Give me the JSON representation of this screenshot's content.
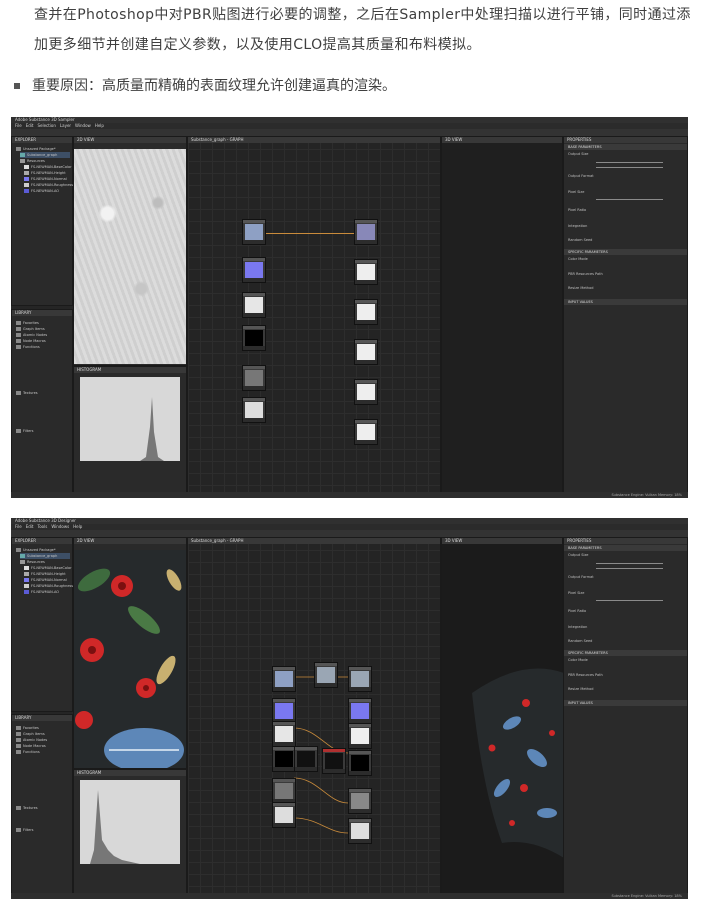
{
  "article": {
    "paragraph": "查并在Photoshop中对PBR贴图进行必要的调整，之后在Sampler中处理扫描以进行平铺，同时通过添加更多细节并创建自定义参数，以及使用CLO提高其质量和布料模拟。",
    "bullet": "重要原因：高质量而精确的表面纹理允许创建逼真的渲染。"
  },
  "screenshots": [
    {
      "window_title": "Adobe Substance 3D Sampler",
      "menu": [
        "File",
        "Edit",
        "Selection",
        "Layer",
        "Window",
        "Help"
      ],
      "explorer_title": "EXPLORER",
      "explorer_items": [
        "Unsaved Package*",
        "Substance_graph",
        "Resources",
        "FS-NEWMAN-BaseColor",
        "FS-NEWMAN-Height",
        "FS-NEWMAN-Normal",
        "FS-NEWMAN-Roughness",
        "FS-NEWMAN-AO"
      ],
      "library_title": "LIBRARY",
      "library_items": [
        "Favorites",
        "Graph Items",
        "Atomic Nodes",
        "Node Macros",
        "Functions",
        "Textures",
        "Filters"
      ],
      "view2d_title": "2D VIEW",
      "histogram_title": "HISTOGRAM",
      "graph_title": "Substance_graph - GRAPH",
      "view3d_title": "3D VIEW",
      "properties_title": "PROPERTIES",
      "properties_sections": [
        "BASE PARAMETERS",
        "SPECIFIC PARAMETERS",
        "INPUT VALUES"
      ],
      "properties_rows": [
        "Output Size",
        "Output Format",
        "Pixel Size",
        "Pixel Ratio",
        "Integration",
        "Random Seed",
        "Color Mode",
        "PBR Resources Path",
        "Resize Method"
      ],
      "status": "Substance Engine: Vulkan  Memory: 18%"
    },
    {
      "window_title": "Adobe Substance 3D Designer",
      "menu": [
        "File",
        "Edit",
        "Tools",
        "Windows",
        "Help"
      ],
      "explorer_title": "EXPLORER",
      "explorer_items": [
        "Unsaved Package*",
        "Substance_graph",
        "Resources",
        "FS-NEWMAN-BaseColor",
        "FS-NEWMAN-Height",
        "FS-NEWMAN-Normal",
        "FS-NEWMAN-Roughness",
        "FS-NEWMAN-AO"
      ],
      "library_title": "LIBRARY",
      "library_items": [
        "Favorites",
        "Graph Items",
        "Atomic Nodes",
        "Node Macros",
        "Functions",
        "Textures",
        "Filters"
      ],
      "view2d_title": "2D VIEW",
      "histogram_title": "HISTOGRAM",
      "graph_title": "Substance_graph - GRAPH",
      "view3d_title": "3D VIEW",
      "properties_title": "PROPERTIES",
      "properties_sections": [
        "BASE PARAMETERS",
        "SPECIFIC PARAMETERS",
        "INPUT VALUES"
      ],
      "properties_rows": [
        "Output Size",
        "Output Format",
        "Pixel Size",
        "Pixel Ratio",
        "Integration",
        "Random Seed",
        "Color Mode",
        "PBR Resources Path",
        "Resize Method"
      ],
      "status": "Substance Engine: Vulkan  Memory: 18%"
    }
  ],
  "colors": {
    "text": "#3f3f3f",
    "ui_bg": "#252525",
    "link": "#c98b3b",
    "normal_map": "#7a78f0",
    "fabric_dark": "#262a2c",
    "flower_red": "#d02828",
    "leaf_blue": "#5d87b8"
  }
}
